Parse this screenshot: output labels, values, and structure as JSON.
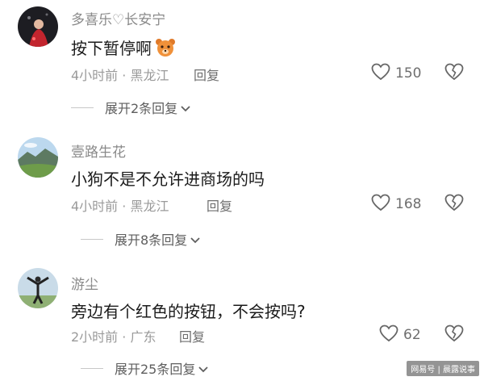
{
  "comments": [
    {
      "username": "多喜乐♡长安宁",
      "text": "按下暂停啊",
      "has_emoji": true,
      "emoji": "bear-face-icon",
      "meta": "4小时前 · 黑龙江",
      "reply": "回复",
      "likes": "150",
      "expand": "展开2条回复"
    },
    {
      "username": "壹路生花",
      "text": "小狗不是不允许进商场的吗",
      "meta": "4小时前 · 黑龙江",
      "reply": "回复",
      "likes": "168",
      "expand": "展开8条回复"
    },
    {
      "username": "游尘",
      "text": "旁边有个红色的按钮，不会按吗?",
      "meta": "2小时前 · 广东",
      "reply": "回复",
      "likes": "62",
      "expand": "展开25条回复"
    }
  ],
  "watermark": "网易号 | 晨露说事",
  "colors": {
    "accent_text": "#1b1b1b",
    "muted_text": "#9a9a9a"
  }
}
